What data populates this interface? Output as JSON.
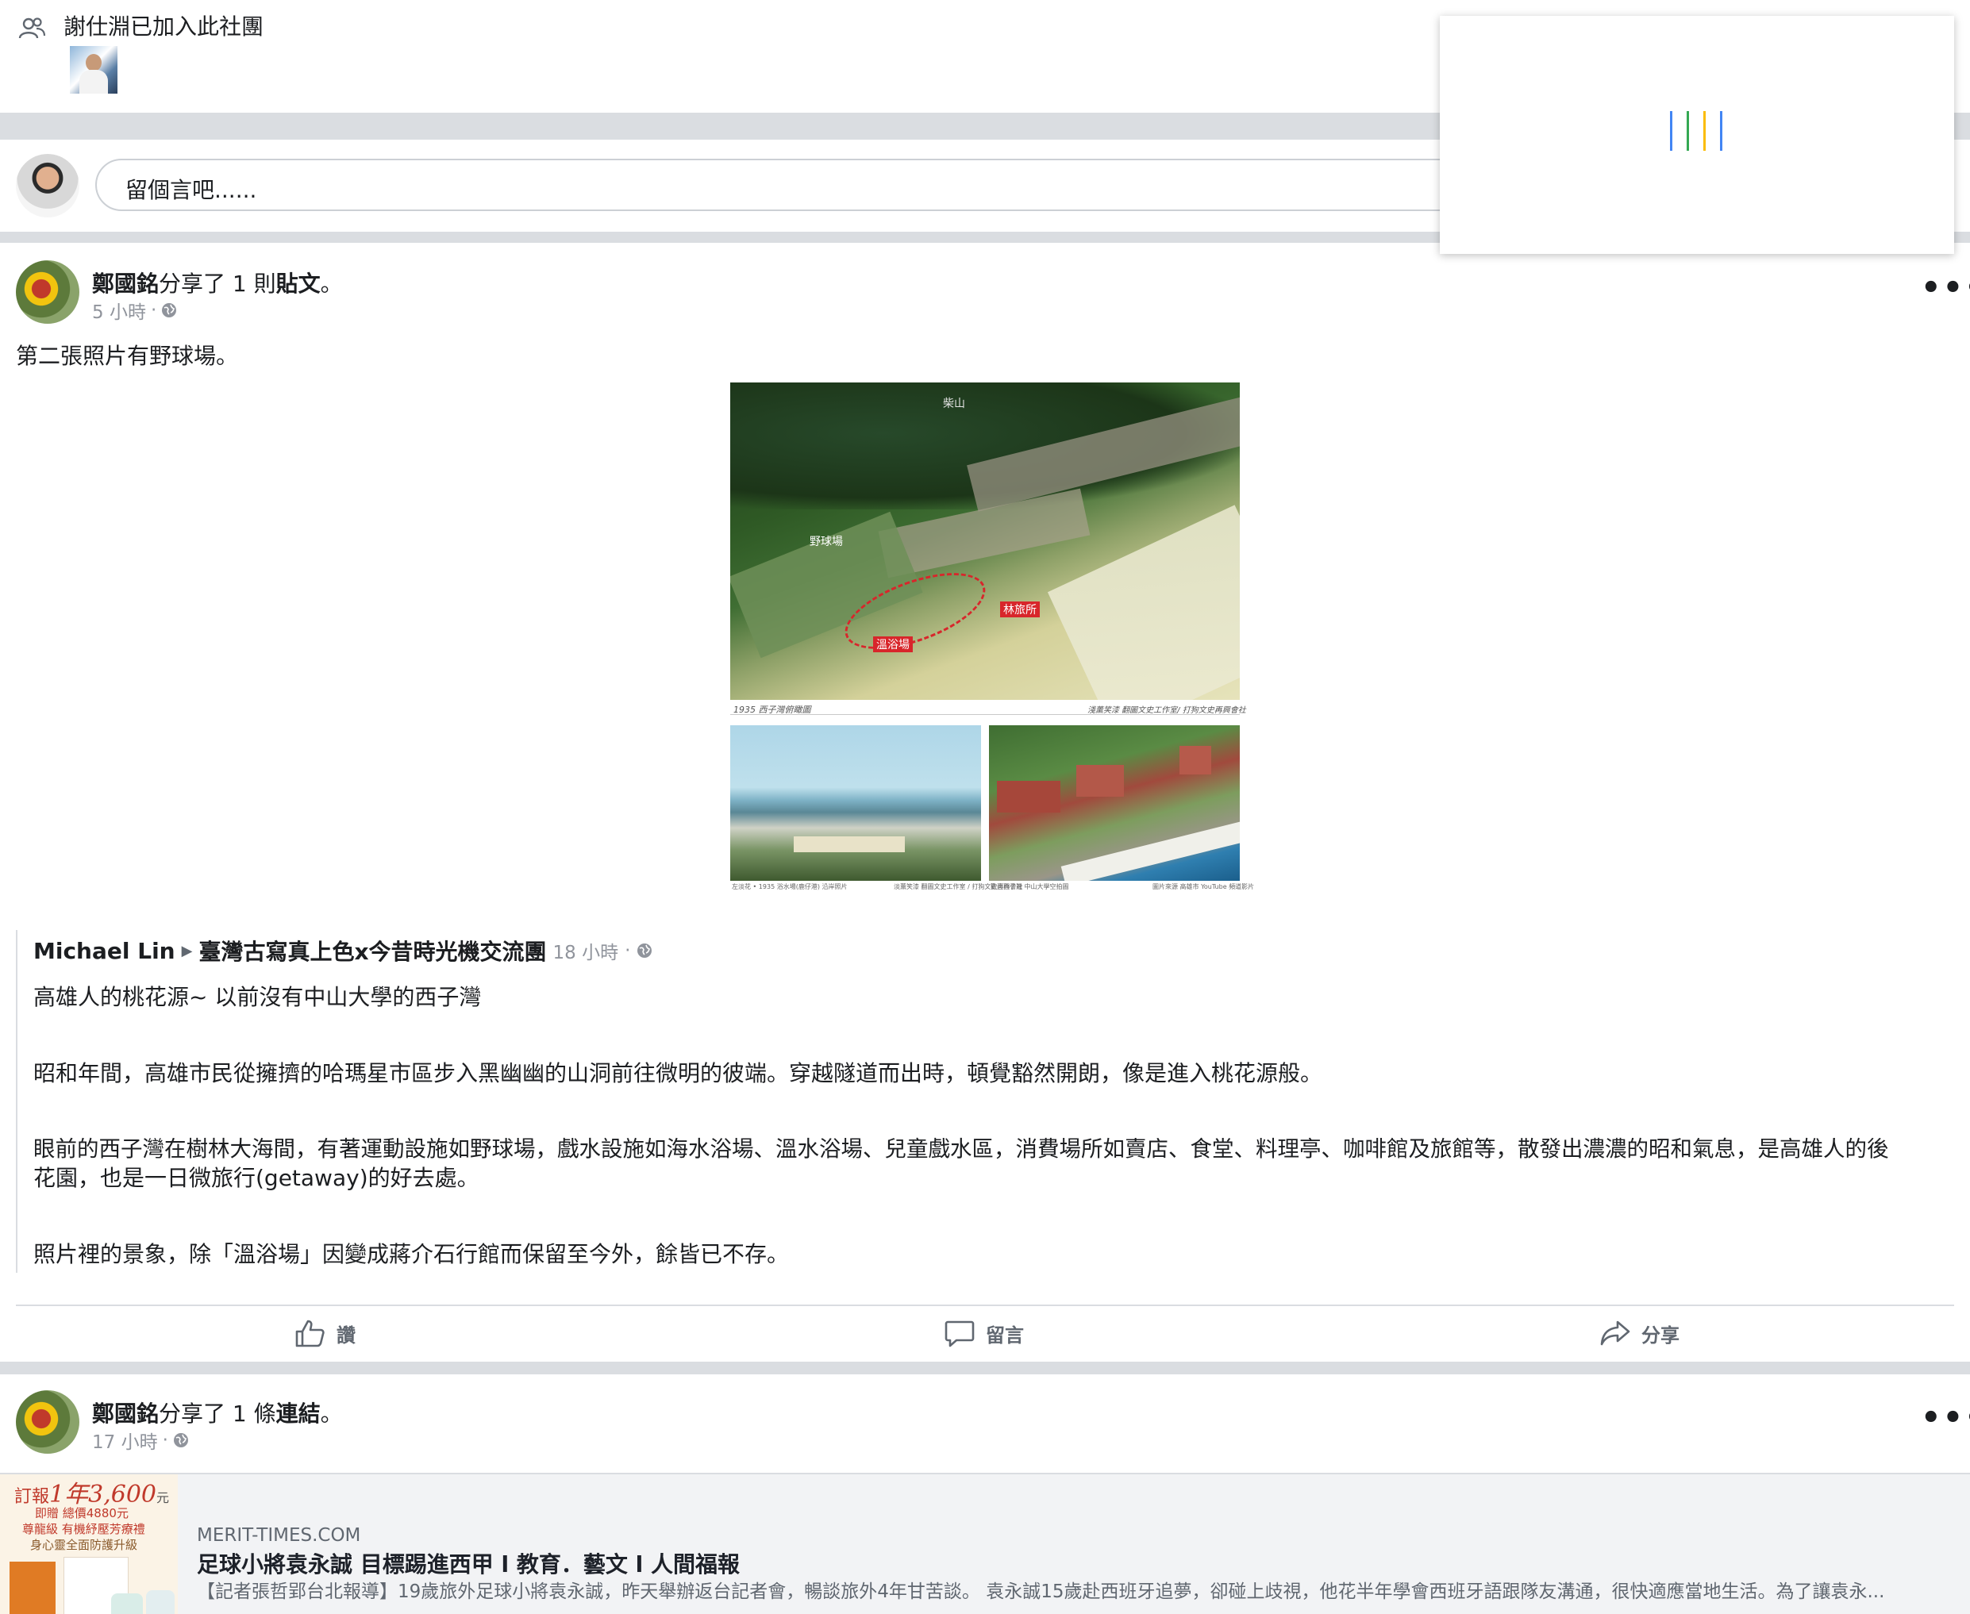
{
  "join_notice": {
    "icon": "group-icon",
    "text": "謝仕淵已加入此社團"
  },
  "composer": {
    "placeholder": "留個言吧......"
  },
  "loading_popup": {
    "bar_colors": [
      "#4285f4",
      "#34a853",
      "#fbbc05",
      "#4285f4"
    ]
  },
  "post1": {
    "author": "鄭國銘",
    "action_prefix": "分享了 1 則",
    "action_object": "貼文",
    "action_suffix": "。",
    "time": "5 小時",
    "separator": "·",
    "privacy_icon": "globe-icon",
    "more_label": "•••",
    "text": "第二張照片有野球場。",
    "photo_captions": {
      "top_left": "1935 西子灣俯瞰圖",
      "top_right": "淺薰笑漆 翻圖文史工作室/ 打狗文史再興會社",
      "bl_left": "左淡花 • 1935 浴水場(鹿仔港) 沿岸照片",
      "bl_right": "淡薰笑漆 翻圖文史工作室 / 打狗文史再興會社",
      "br_left": "歡迎西子灣 中山大學空拍圖",
      "br_right": "圖片來源 高雄市 YouTube 頻道影片"
    },
    "photo_labels": {
      "mountain": "柴山",
      "field": "野球場",
      "onsen": "溫浴場",
      "guesthouse": "林旅所"
    },
    "shared": {
      "author": "Michael Lin",
      "arrow": "▶",
      "group": "臺灣古寫真上色x今昔時光機交流團",
      "time": "18 小時",
      "separator": "·",
      "title": "高雄人的桃花源~ 以前沒有中山大學的西子灣",
      "p1": "昭和年間，高雄市民從擁擠的哈瑪星市區步入黑幽幽的山洞前往微明的彼端。穿越隧道而出時，頓覺豁然開朗，像是進入桃花源般。",
      "p2a": "眼前的西子灣在樹林大海間，有著運動設施如野球場，戲水設施如海水浴場、溫水浴場、兒童戲水區，消費場所如賣店、食堂、料理亭、咖啡館及旅館等，散發出濃濃的昭和氣息，是高雄人的後",
      "p2b": "花園，也是一日微旅行(getaway)的好去處。",
      "p3": "照片裡的景象，除「溫浴場」因變成蔣介石行館而保留至今外，餘皆已不存。"
    },
    "actions": {
      "like": "讚",
      "comment": "留言",
      "share": "分享"
    }
  },
  "post2": {
    "author": "鄭國銘",
    "action_prefix": "分享了 1 條",
    "action_object": "連結",
    "action_suffix": "。",
    "time": "17 小時",
    "separator": "·",
    "more_label": "•••",
    "link": {
      "ad_line1": "訂報",
      "ad_year": "1年",
      "ad_price": "3,600",
      "ad_unit": "元",
      "ad_line2": "即贈 總價4880元",
      "ad_line3": "尊龍級 有機紓壓芳療禮",
      "ad_line4": "身心靈全面防護升級",
      "domain": "MERIT-TIMES.COM",
      "title": "足球小將袁永誠 目標踢進西甲 l 教育．藝文 l 人間福報",
      "desc": "【記者張哲郢台北報導】19歲旅外足球小將袁永誠，昨天舉辦返台記者會，暢談旅外4年甘苦談。 袁永誠15歲赴西班牙追夢，卻碰上歧視，他花半年學會西班牙語跟隊友溝通，很快適應當地生活。為了讓袁永..."
    }
  }
}
